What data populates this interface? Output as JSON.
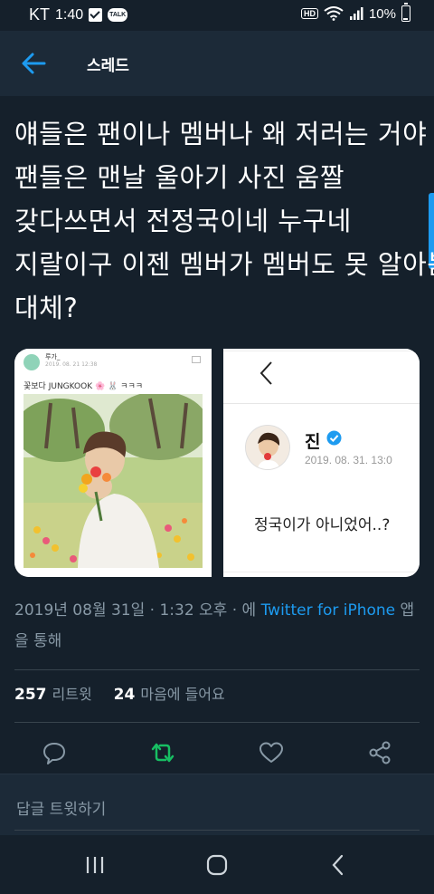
{
  "status": {
    "carrier": "KT",
    "time": "1:40",
    "talk_badge": "TALK",
    "hd_badge": "HD",
    "battery": "10%"
  },
  "header": {
    "title": "스레드"
  },
  "tweet": {
    "lines": [
      "얘들은 팬이나 멤버나 왜 저러는 거야",
      "팬들은 맨날 울아기 사진 움짤",
      "갖다쓰면서 전정국이네 누구네",
      "지랄이구 이젠 멤버가 멤버도 못 알아봄",
      "대체?"
    ]
  },
  "media": {
    "left": {
      "name": "루가_",
      "date": "2019. 08. 21 12:38",
      "caption": "꽃보다 JUNGKOOK",
      "caption_tail": "ㅋㅋㅋ"
    },
    "right": {
      "name": "진",
      "date": "2019. 08. 31. 13:0",
      "text": "정국이가 아니었어..?"
    }
  },
  "meta": {
    "datetime": "2019년 08월 31일 · 1:32 오후 · 에",
    "source_link": "Twitter for iPhone",
    "suffix": "앱을 통해"
  },
  "stats": {
    "retweets": "257",
    "retweets_label": "리트윗",
    "likes": "24",
    "likes_label": "마음에 들어요"
  },
  "reply": {
    "placeholder": "답글 트윗하기"
  },
  "colors": {
    "background": "#15202b",
    "header": "#1c2a38",
    "accent": "#1d9bf0",
    "retweet_green": "#17bf63",
    "muted": "#8899a6"
  }
}
